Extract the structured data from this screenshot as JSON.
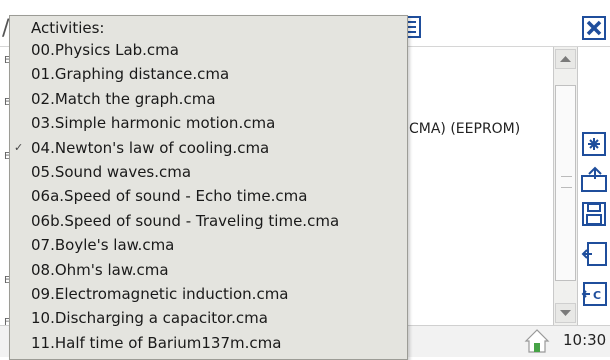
{
  "toolbar": {
    "close_icon": "close-icon",
    "file_icon": "document-icon"
  },
  "main": {
    "device_text": "CMA) (EEPROM)"
  },
  "side_tools": [
    "settings-icon",
    "export-icon",
    "save-icon",
    "import-icon",
    "import-c-icon"
  ],
  "status": {
    "time": "10:30"
  },
  "menu": {
    "header": "Activities:",
    "selected_index": 4,
    "items": [
      "00.Physics Lab.cma",
      "01.Graphing distance.cma",
      "02.Match the graph.cma",
      "03.Simple harmonic motion.cma",
      "04.Newton's law of cooling.cma",
      "05.Sound waves.cma",
      "06a.Speed of sound - Echo time.cma",
      "06b.Speed of sound - Traveling time.cma",
      "07.Boyle's law.cma",
      "08.Ohm's law.cma",
      "09.Electromagnetic induction.cma",
      "10.Discharging a capacitor.cma",
      "11.Half time of Barium137m.cma"
    ]
  },
  "colors": {
    "menu_bg": "#e4e4df",
    "close_blue": "#1f4e9c",
    "home_green": "#46a346"
  }
}
